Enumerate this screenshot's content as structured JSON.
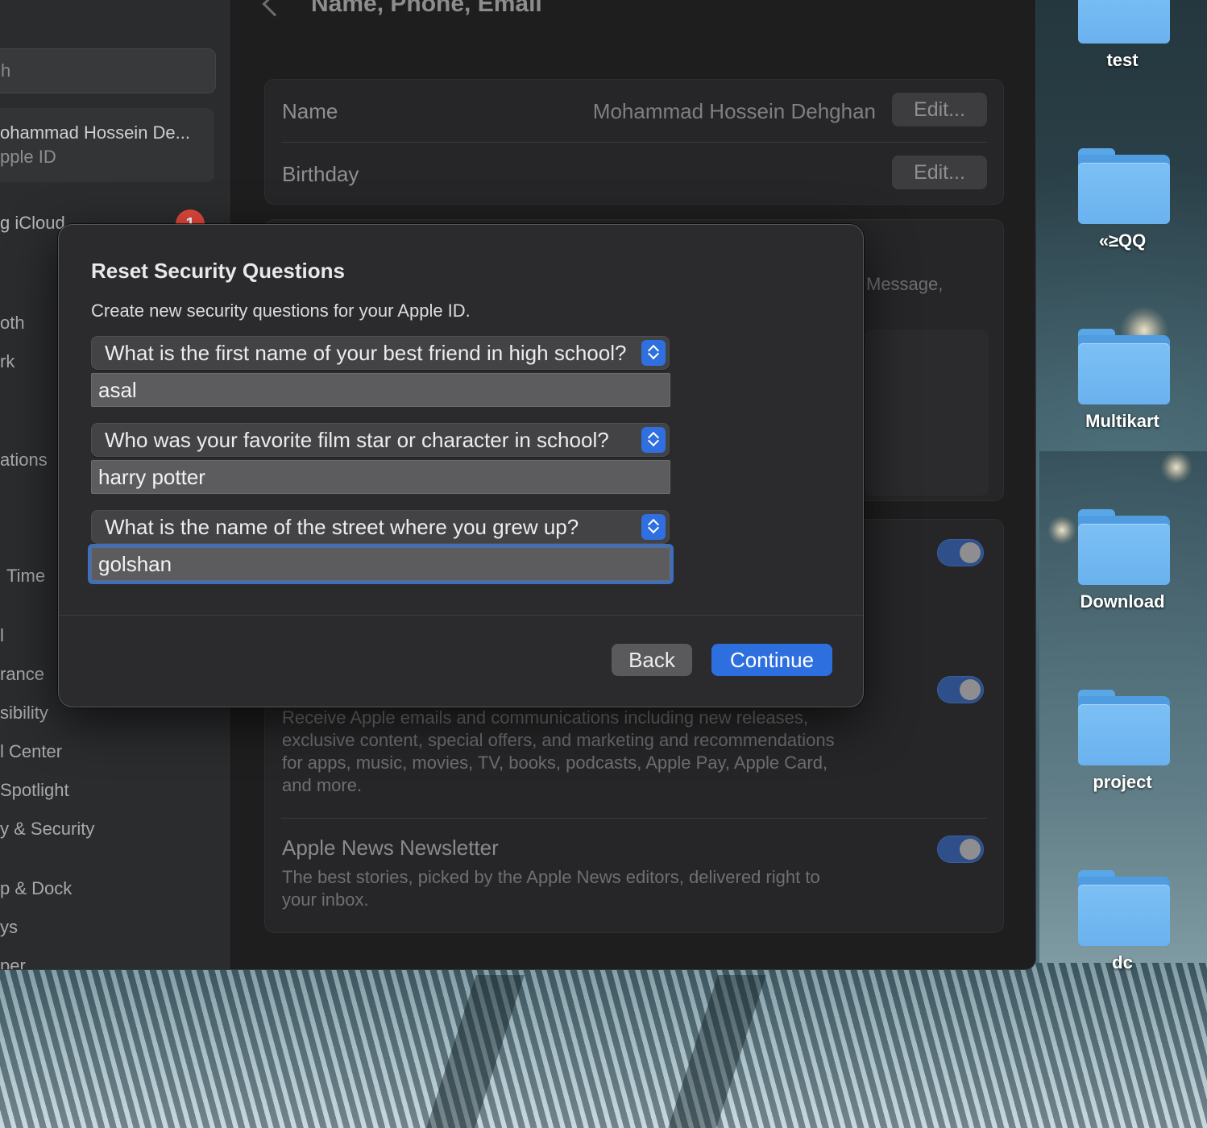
{
  "window": {
    "title": "Name, Phone, Email"
  },
  "sidebar": {
    "search_placeholder": "h",
    "account_name": "ohammad Hossein  De...",
    "account_sub": "pple ID",
    "icloud_label": "g iCloud",
    "icloud_badge": "1",
    "items": [
      "oth",
      "rk",
      "ations",
      "Time",
      "l",
      "rance",
      "sibility",
      "l Center",
      "Spotlight",
      "y & Security",
      "p & Dock",
      "ys",
      "per"
    ]
  },
  "main": {
    "name_label": "Name",
    "name_value": "Mohammad Hossein Dehghan",
    "name_edit": "Edit...",
    "birthday_label": "Birthday",
    "birthday_edit": "Edit...",
    "message_fragment": "Message,",
    "announcements_desc": "Receive Apple emails and communications including new releases, exclusive content, special offers, and marketing and recommendations for apps, music, movies, TV, books, podcasts, Apple Pay, Apple Card, and more.",
    "newsletter_title": "Apple News Newsletter",
    "newsletter_desc": "The best stories, picked by the Apple News editors, delivered right to your inbox."
  },
  "dialog": {
    "title": "Reset Security Questions",
    "subtitle": "Create new security questions for your Apple ID.",
    "questions": [
      {
        "question": "What is the first name of your best friend in high school?",
        "answer": "asal"
      },
      {
        "question": "Who was your favorite film star or character in school?",
        "answer": "harry potter"
      },
      {
        "question": "What is the name of the street where you grew up?",
        "answer": "golshan"
      }
    ],
    "back_label": "Back",
    "continue_label": "Continue"
  },
  "desktop": {
    "folders": [
      "test",
      "«≥QQ",
      "Multikart",
      "Download",
      "project",
      "dc"
    ]
  },
  "colors": {
    "accent": "#2e6fe0",
    "folder": "#6ab2ef",
    "badge": "#e5483d"
  }
}
